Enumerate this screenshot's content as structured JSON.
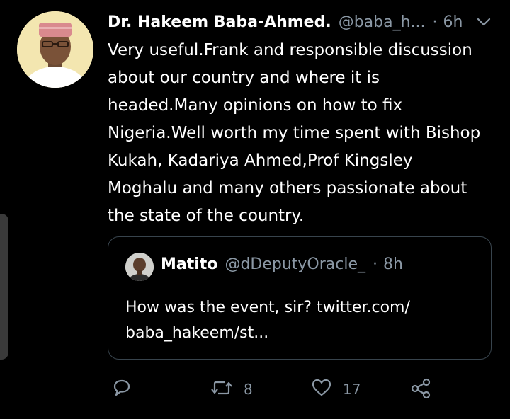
{
  "tweet": {
    "author_name": "Dr. Hakeem Baba-Ahmed.",
    "author_handle": "@baba_h...",
    "separator": "·",
    "time": "6h",
    "text_lines": [
      "Very useful.Frank and responsible discussion",
      "about our country and where it is",
      "headed.Many opinions on how to fix",
      "Nigeria.Well worth my time spent with Bishop",
      "Kukah, Kadariya Ahmed,Prof Kingsley",
      "Moghalu and many others passionate about",
      "the state of the country."
    ]
  },
  "quoted": {
    "author_name": "Matito",
    "author_handle": "@dDeputyOracle_",
    "separator": "·",
    "time": "8h",
    "text_lines": [
      "How was the event, sir? twitter.com/",
      "baba_hakeem/st..."
    ]
  },
  "actions": {
    "retweet_count": "8",
    "like_count": "17"
  },
  "colors": {
    "background": "#000000",
    "text": "#ffffff",
    "muted": "#8b98a5",
    "border": "#38444d"
  },
  "icons": [
    "reply-icon",
    "retweet-icon",
    "like-icon",
    "share-icon",
    "chevron-down-icon"
  ]
}
